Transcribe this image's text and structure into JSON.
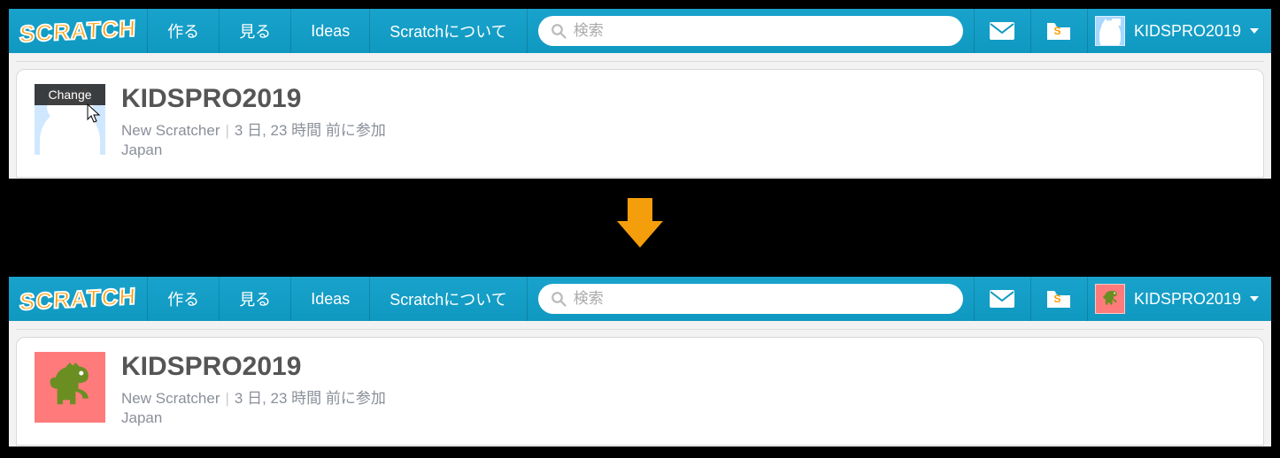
{
  "nav": {
    "logo_text": "SCRATCH",
    "items": [
      "作る",
      "見る",
      "Ideas",
      "Scratchについて"
    ],
    "search_placeholder": "検索",
    "username": "KIDSPRO2019"
  },
  "profile": {
    "change_label": "Change",
    "username": "KIDSPRO2019",
    "role": "New Scratcher",
    "joined": "3 日, 23 時間 前に参加",
    "country": "Japan"
  }
}
